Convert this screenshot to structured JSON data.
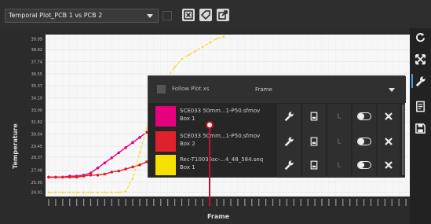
{
  "toolbar": {
    "plot_name": "Temporal Plot_PCB 1 vs PCB 2",
    "buttons": [
      "close-window-icon",
      "expand-icon",
      "popout-icon"
    ]
  },
  "chart_data": {
    "type": "line",
    "ylabel": "Temperature",
    "xlabel": "Frame",
    "y_ticks": [
      "24.91",
      "25.90",
      "27.08",
      "28.37",
      "29.45",
      "30.64",
      "31.82",
      "33.00",
      "34.19",
      "35.37",
      "36.55",
      "37.74",
      "38.92",
      "39.99"
    ],
    "ylim": [
      24.5,
      40.4
    ],
    "x_tick_count": 52,
    "grid": true,
    "series": [
      {
        "color": "#e5007d",
        "values": [
          26.4,
          26.4,
          26.4,
          26.5,
          26.5,
          26.6,
          26.8,
          27.3,
          27.8,
          28.3,
          28.8,
          29.3,
          29.8,
          30.3,
          30.8,
          31.3,
          31.8,
          32.3
        ]
      },
      {
        "color": "#e0202a",
        "values": [
          26.4,
          26.4,
          26.4,
          26.4,
          26.4,
          26.5,
          26.6,
          26.6,
          26.7,
          26.9,
          27.0,
          27.2,
          27.4,
          27.6,
          27.9,
          28.3,
          28.8,
          29.3
        ]
      },
      {
        "color": "#f0e050",
        "values": [
          24.9,
          24.9,
          24.9,
          24.9,
          24.9,
          24.9,
          24.9,
          24.9,
          24.9,
          24.9,
          24.9,
          25.0,
          26.3,
          28.8,
          31.2,
          33.6,
          35.0,
          36.2,
          37.2,
          38.0,
          38.4,
          38.8,
          39.2,
          39.6,
          40.0,
          40.2
        ]
      }
    ]
  },
  "overlay": {
    "follow_label": "Follow  Plot xs",
    "frame_select": "Frame",
    "L_label": "L",
    "items": [
      {
        "color": "#e5007d",
        "line1": "SCE033 50mm...1-P50.sfmov",
        "line2": "Box 1"
      },
      {
        "color": "#e0202a",
        "line1": "SCE033 50mm...1-P50.sfmov",
        "line2": "Box 2"
      },
      {
        "color": "#f5e000",
        "line1": "Rec-T10036sc-...4_48_584.seq",
        "line2": "Box 1"
      }
    ]
  },
  "sidebar": [
    "refresh-icon",
    "shuffle-icon",
    "wrench-icon",
    "report-icon",
    "save-icon"
  ]
}
